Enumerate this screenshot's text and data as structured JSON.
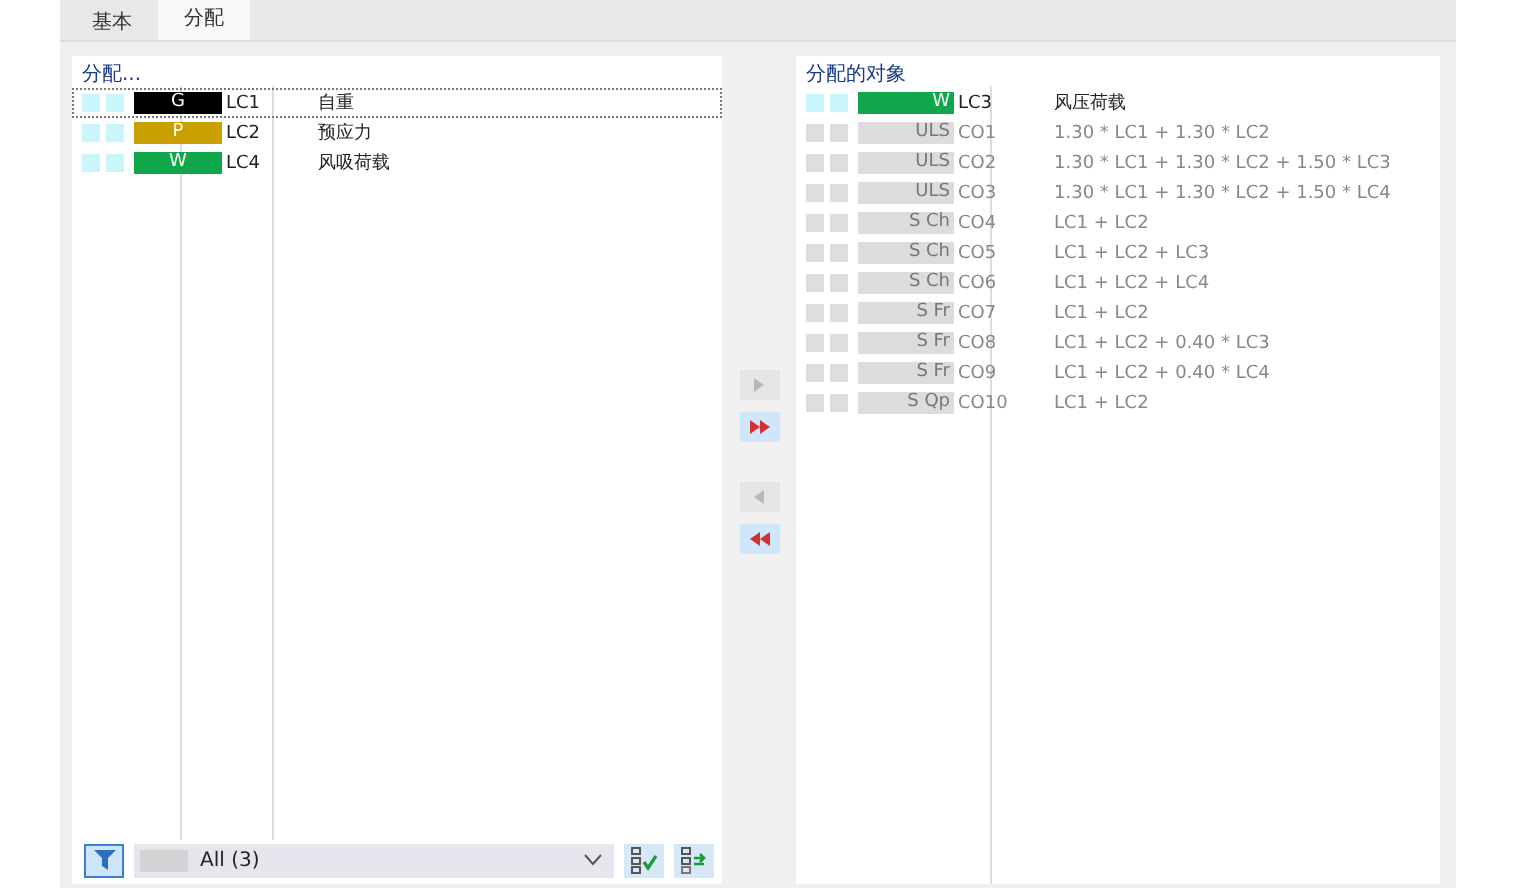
{
  "tabs": [
    {
      "label": "基本",
      "selected": false
    },
    {
      "label": "分配",
      "selected": true
    }
  ],
  "available": {
    "title": "分配...",
    "rows": [
      {
        "tag": "G",
        "color": "#000000",
        "code": "LC1",
        "description": "自重",
        "disabled": false,
        "selected": true
      },
      {
        "tag": "P",
        "color": "#c8a000",
        "code": "LC2",
        "description": "预应力",
        "disabled": false,
        "selected": false
      },
      {
        "tag": "W",
        "color": "#10a64a",
        "code": "LC4",
        "description": "风吸荷载",
        "disabled": false,
        "selected": false
      }
    ]
  },
  "transfer_buttons": [
    {
      "kind": "one-right",
      "disabled": true
    },
    {
      "kind": "all-right",
      "disabled": false
    },
    {
      "kind": "one-left",
      "disabled": true
    },
    {
      "kind": "all-left",
      "disabled": false
    }
  ],
  "assigned": {
    "title": "分配的对象",
    "rows": [
      {
        "tag": "W",
        "color": "#10a64a",
        "code": "LC3",
        "description": "风压荷载",
        "disabled": false
      },
      {
        "tag": "ULS",
        "color": "#dcdcdc",
        "code": "CO1",
        "description": "1.30 * LC1 + 1.30 * LC2",
        "disabled": true
      },
      {
        "tag": "ULS",
        "color": "#dcdcdc",
        "code": "CO2",
        "description": "1.30 * LC1 + 1.30 * LC2 + 1.50 * LC3",
        "disabled": true
      },
      {
        "tag": "ULS",
        "color": "#dcdcdc",
        "code": "CO3",
        "description": "1.30 * LC1 + 1.30 * LC2 + 1.50 * LC4",
        "disabled": true
      },
      {
        "tag": "S Ch",
        "color": "#dcdcdc",
        "code": "CO4",
        "description": "LC1 + LC2",
        "disabled": true
      },
      {
        "tag": "S Ch",
        "color": "#dcdcdc",
        "code": "CO5",
        "description": "LC1 + LC2 + LC3",
        "disabled": true
      },
      {
        "tag": "S Ch",
        "color": "#dcdcdc",
        "code": "CO6",
        "description": "LC1 + LC2 + LC4",
        "disabled": true
      },
      {
        "tag": "S Fr",
        "color": "#dcdcdc",
        "code": "CO7",
        "description": "LC1 + LC2",
        "disabled": true
      },
      {
        "tag": "S Fr",
        "color": "#dcdcdc",
        "code": "CO8",
        "description": "LC1 + LC2 + 0.40 * LC3",
        "disabled": true
      },
      {
        "tag": "S Fr",
        "color": "#dcdcdc",
        "code": "CO9",
        "description": "LC1 + LC2 + 0.40 * LC4",
        "disabled": true
      },
      {
        "tag": "S Qp",
        "color": "#dcdcdc",
        "code": "CO10",
        "description": "LC1 + LC2",
        "disabled": true
      }
    ]
  },
  "filter": {
    "on": true,
    "value": "All (3)"
  }
}
